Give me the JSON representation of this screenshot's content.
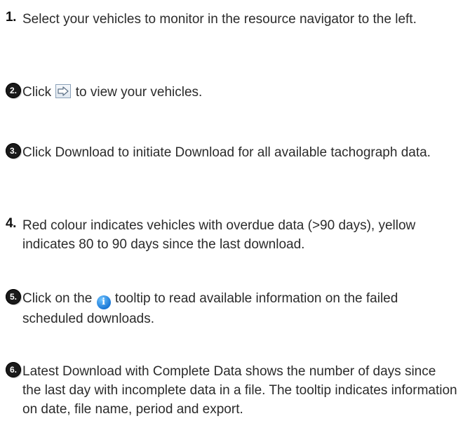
{
  "steps": [
    {
      "marker": "1.",
      "text": "Select your vehicles to monitor in the resource navigator to the left."
    },
    {
      "marker": "2.",
      "text_before": "Click ",
      "icon": "next-arrow-icon",
      "text_after": " to view your vehicles."
    },
    {
      "marker": "3.",
      "text": "Click Download to initiate Download for all available tachograph data."
    },
    {
      "marker": "4.",
      "text": "Red colour indicates vehicles with overdue data (>90 days), yellow indicates 80 to 90 days since the last download."
    },
    {
      "marker": "5.",
      "text_before": "Click on the ",
      "icon": "info-icon",
      "text_after": " tooltip to read available information on the failed scheduled downloads."
    },
    {
      "marker": "6.",
      "text": "Latest Download with Complete Data shows the number of days since the last day with incomplete data in a file. The tooltip indicates information on date, file name, period and export."
    }
  ],
  "colors": {
    "text": "#2b2b2b",
    "badge": "#1a1a1a",
    "info_icon": "#1a78d6"
  }
}
